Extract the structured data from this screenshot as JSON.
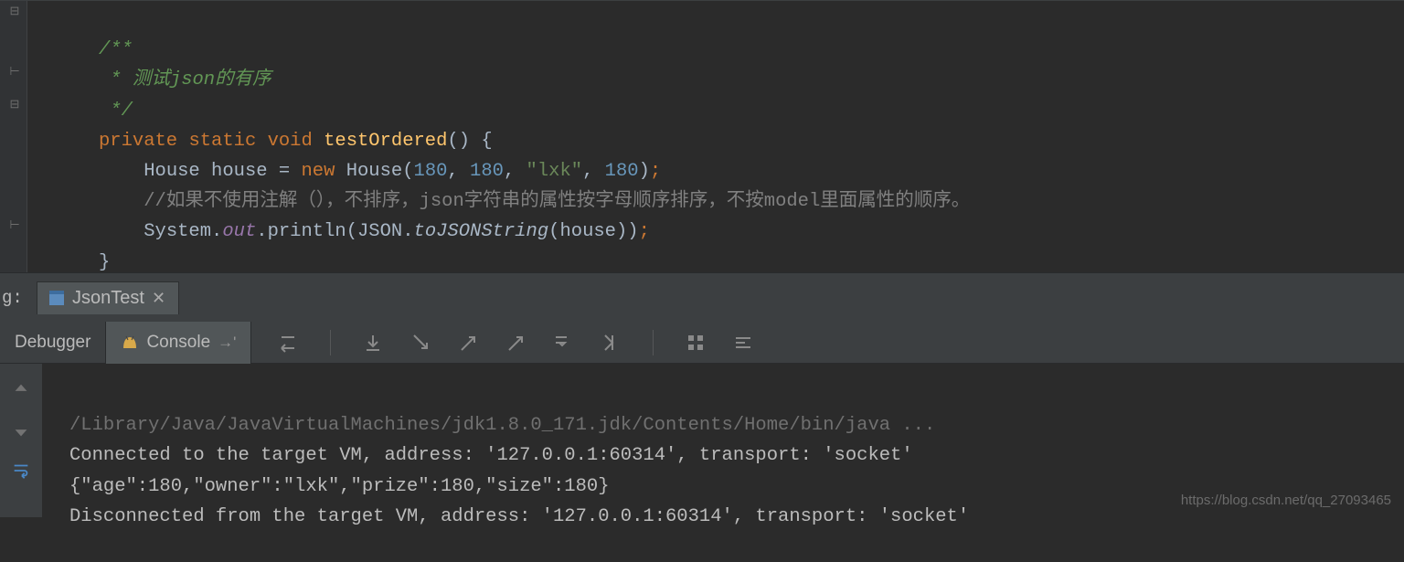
{
  "code": {
    "doc1": "/**",
    "doc2": " * 测试json的有序",
    "doc3": " */",
    "kw_private": "private",
    "kw_static": "static",
    "kw_void": "void",
    "method_name": "testOrdered",
    "method_sig_tail": "() {",
    "type_House": "House",
    "var_house": "house",
    "eq": " = ",
    "kw_new": "new",
    "ctor": "House",
    "arg_180a": "180",
    "arg_180b": "180",
    "arg_str": "\"lxk\"",
    "arg_180c": "180",
    "semi": ";",
    "cmt_note": "//如果不使用注解（），不排序，json字符串的属性按字母顺序排序，不按model里面属性的顺序。",
    "sys": "System",
    "dot": ".",
    "out": "out",
    "println": "println",
    "json_cls": "JSON",
    "tojson": "toJSONString",
    "arg_house": "house",
    "close_brace": "}"
  },
  "runbar": {
    "left_label": "g:",
    "tab_name": "JsonTest"
  },
  "debugrow": {
    "tab_debugger": "Debugger",
    "tab_console": "Console",
    "arrow_label": "→'"
  },
  "console": {
    "line1": "/Library/Java/JavaVirtualMachines/jdk1.8.0_171.jdk/Contents/Home/bin/java ...",
    "line2": "Connected to the target VM, address: '127.0.0.1:60314', transport: 'socket'",
    "line3": "{\"age\":180,\"owner\":\"lxk\",\"prize\":180,\"size\":180}",
    "line4": "Disconnected from the target VM, address: '127.0.0.1:60314', transport: 'socket'"
  },
  "watermark": "https://blog.csdn.net/qq_27093465"
}
